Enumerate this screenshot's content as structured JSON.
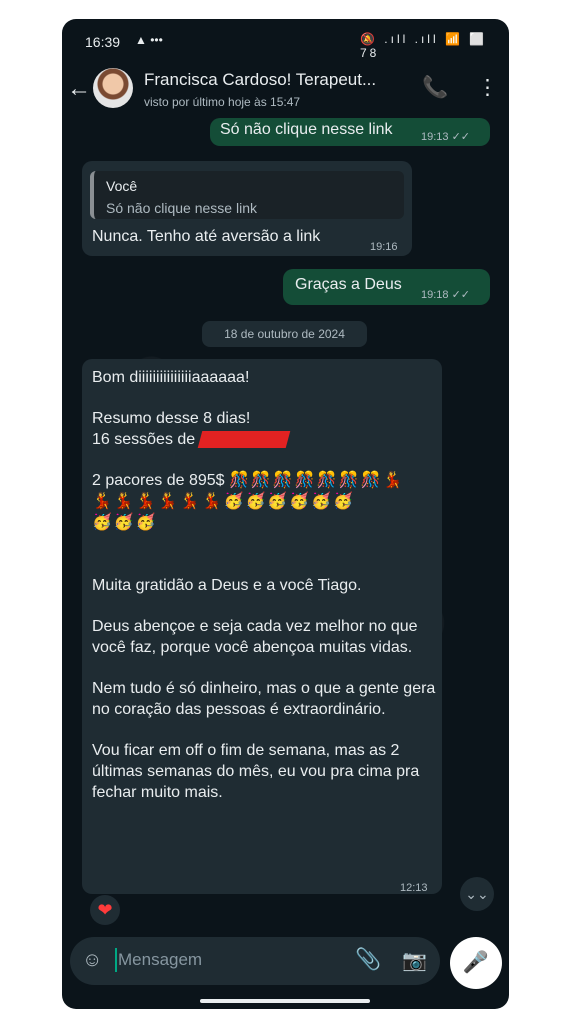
{
  "status": {
    "time": "16:39",
    "notif_icons": "▲ •••",
    "right_icons": "🔕 .ıll .ıll 📶 ⬜",
    "battery": "78"
  },
  "header": {
    "contact_name": "Francisca Cardoso! Terapeut...",
    "last_seen": "visto por último hoje às 15:47"
  },
  "messages": [
    {
      "text": "Só não clique nesse link",
      "time": "19:13",
      "ticks": "✓✓"
    },
    {
      "quote_author": "Você",
      "quote_text": "Só não clique nesse link",
      "text": "Nunca. Tenho até aversão a  link",
      "time": "19:16"
    },
    {
      "text": "Graças a Deus",
      "time": "19:18",
      "ticks": "✓✓"
    }
  ],
  "date_chip": "18 de outubro de 2024",
  "long_message": {
    "line1": "Bom diiiiiiiiiiiiiiiaaaaaa!",
    "line2": "Resumo desse 8 dias!",
    "line3": "16 sessões de",
    "line4": "2 pacores de 895$",
    "emoji1": "🎊🎊🎊🎊🎊🎊🎊💃",
    "emoji2": "💃💃💃💃💃💃🥳🥳🥳🥳🥳🥳",
    "emoji3": "🥳🥳🥳",
    "para1": "Muita gratidão a Deus e a você Tiago.",
    "para2": "Deus abençoe e seja cada vez melhor no que você faz, porque você abençoa muitas vidas.",
    "para3": "Nem tudo é só dinheiro, mas o que a gente gera no coração das pessoas é extraordinário.",
    "para4": "Vou ficar em off o fim de semana, mas as 2 últimas semanas do mês, eu vou pra cima pra fechar muito mais.",
    "time": "12:13",
    "reaction": "❤"
  },
  "input": {
    "placeholder": "Mensagem"
  },
  "icons": {
    "back": "←",
    "call": "📞",
    "menu": "⋮",
    "sticker": "☺",
    "clip": "📎",
    "camera": "📷",
    "mic": "🎤",
    "scroll_down": "⌄⌄"
  }
}
